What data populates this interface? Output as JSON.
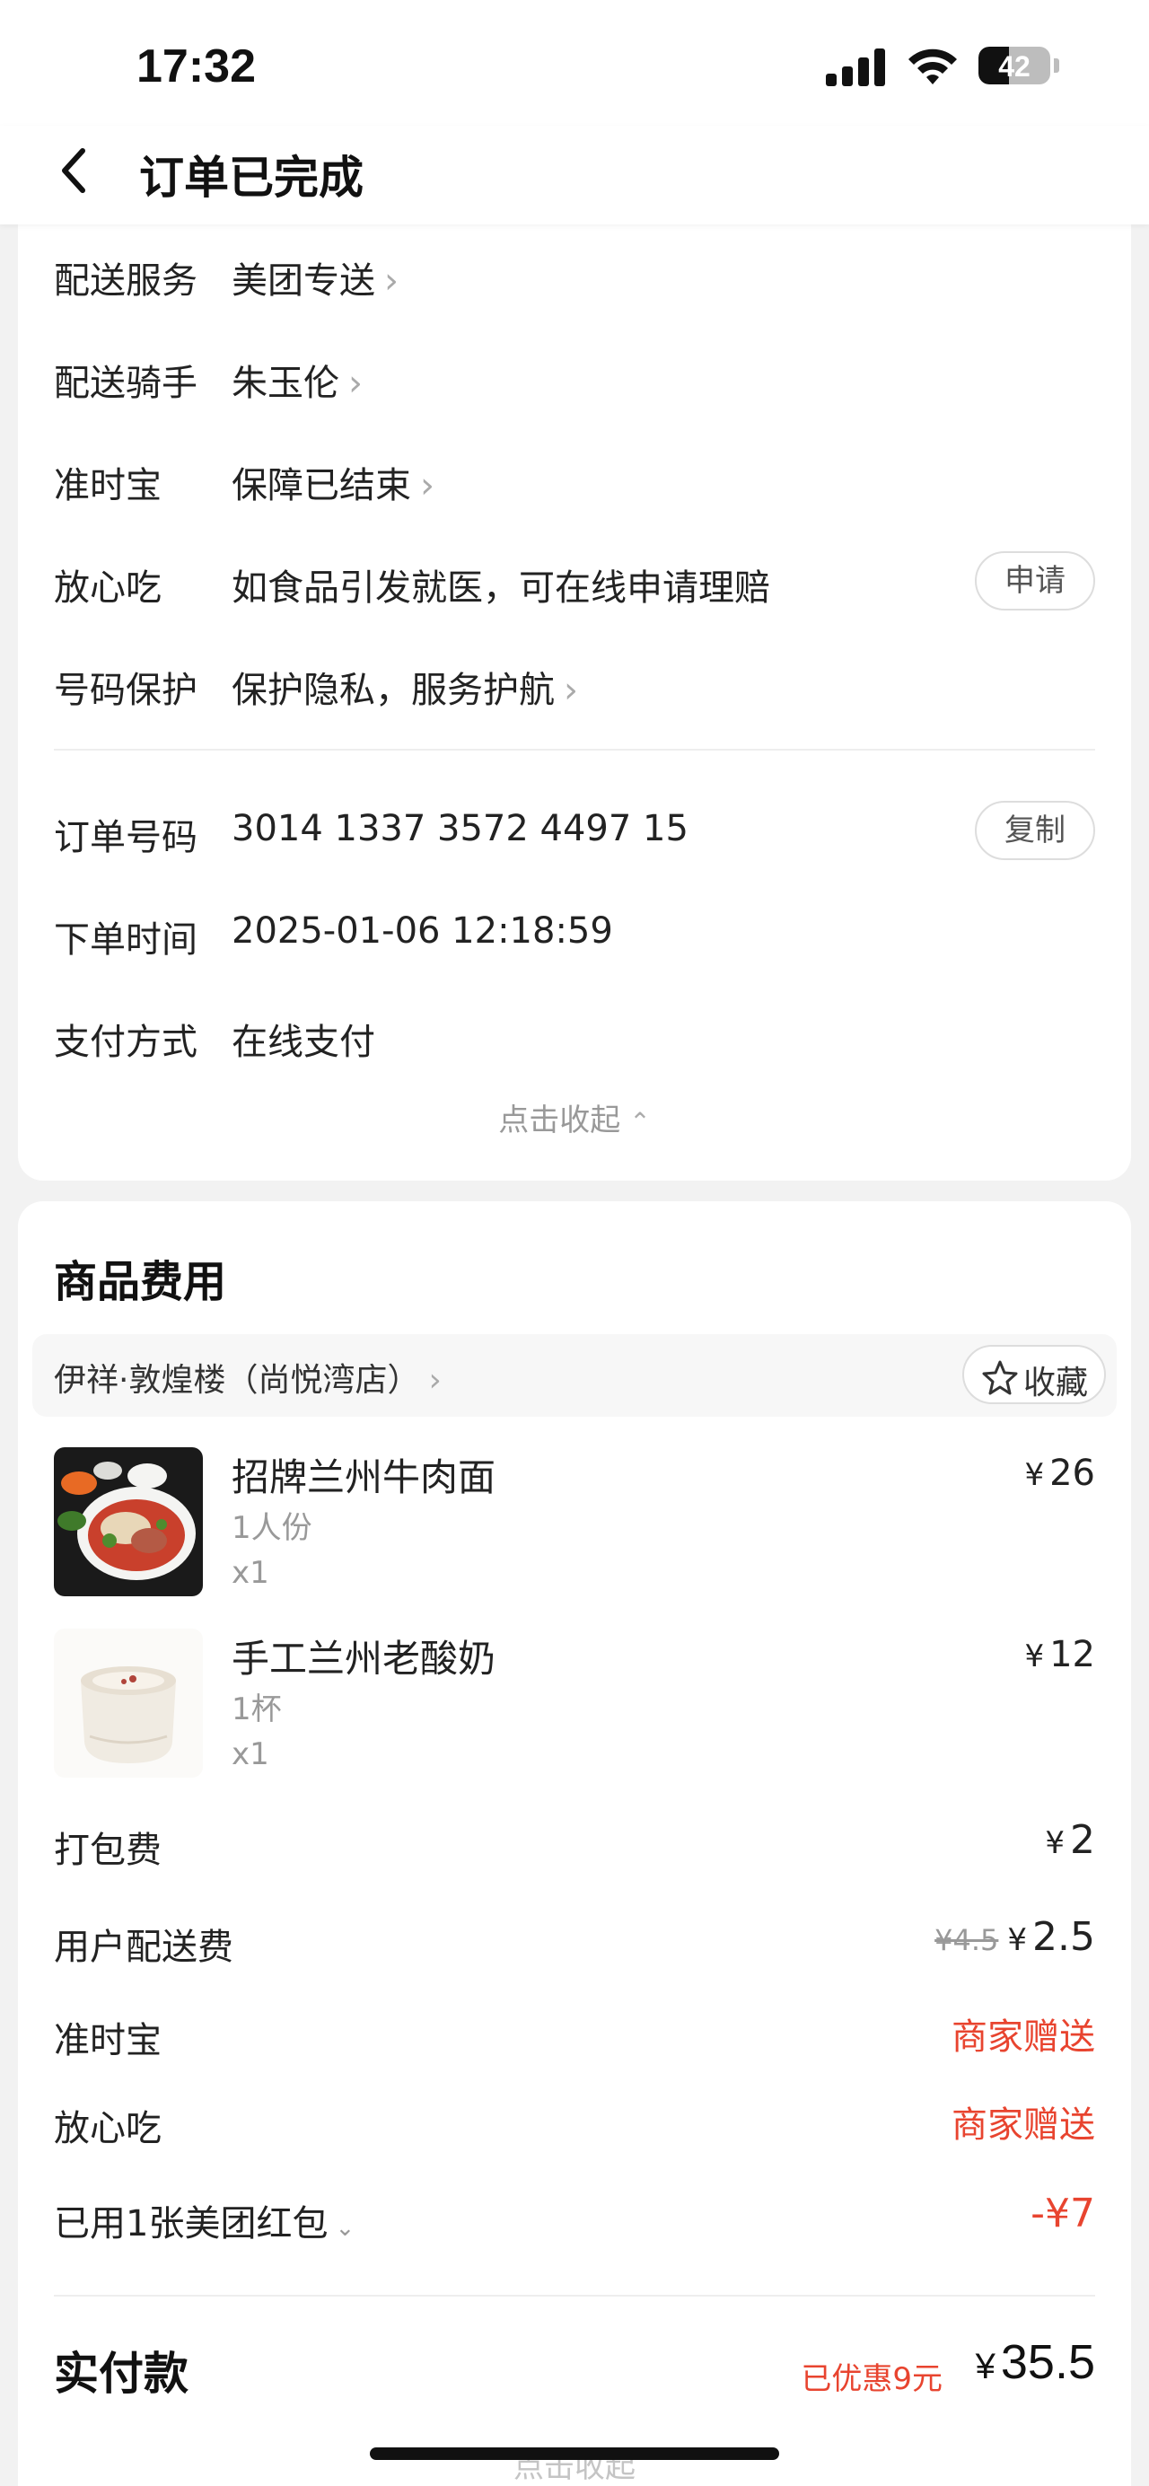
{
  "status_bar": {
    "time": "17:32",
    "battery": "42"
  },
  "nav": {
    "title": "订单已完成"
  },
  "delivery_info": {
    "rows": [
      {
        "label": "配送服务",
        "value": "美团专送"
      },
      {
        "label": "配送骑手",
        "value": "朱玉伦"
      },
      {
        "label": "准时宝",
        "value": "保障已结束"
      },
      {
        "label": "放心吃",
        "value": "如食品引发就医，可在线申请理赔",
        "button": "申请"
      },
      {
        "label": "号码保护",
        "value": "保护隐私，服务护航"
      }
    ]
  },
  "order_info": {
    "order_no_label": "订单号码",
    "order_no": "3014 1337 3572 4497 15",
    "copy_label": "复制",
    "time_label": "下单时间",
    "time": "2025-01-06 12:18:59",
    "payment_label": "支付方式",
    "payment": "在线支付",
    "collapse_label": "点击收起"
  },
  "fees": {
    "title": "商品费用",
    "shop_name": "伊祥·敦煌楼（尚悦湾店）",
    "favorite_label": "收藏",
    "products": [
      {
        "name": "招牌兰州牛肉面",
        "spec": "1人份",
        "qty": "x1",
        "currency": "¥",
        "price": "26"
      },
      {
        "name": "手工兰州老酸奶",
        "spec": "1杯",
        "qty": "x1",
        "currency": "¥",
        "price": "12"
      }
    ],
    "packing_label": "打包费",
    "packing_currency": "¥",
    "packing_value": "2",
    "delivery_fee_label": "用户配送费",
    "delivery_fee_original": "¥4.5",
    "delivery_fee_currency": "¥",
    "delivery_fee_value": "2.5",
    "ontime_label": "准时宝",
    "ontime_value": "商家赠送",
    "safe_label": "放心吃",
    "safe_value": "商家赠送",
    "redpacket_label": "已用1张美团红包",
    "redpacket_value": "-¥7",
    "total_label": "实付款",
    "total_saved": "已优惠9元",
    "total_currency": "¥",
    "total_value": "35.5",
    "bottom_collapse_label": "点击收起"
  },
  "colors": {
    "accent_red": "#e8442f",
    "background": "#f2f2f2",
    "card": "#ffffff"
  }
}
